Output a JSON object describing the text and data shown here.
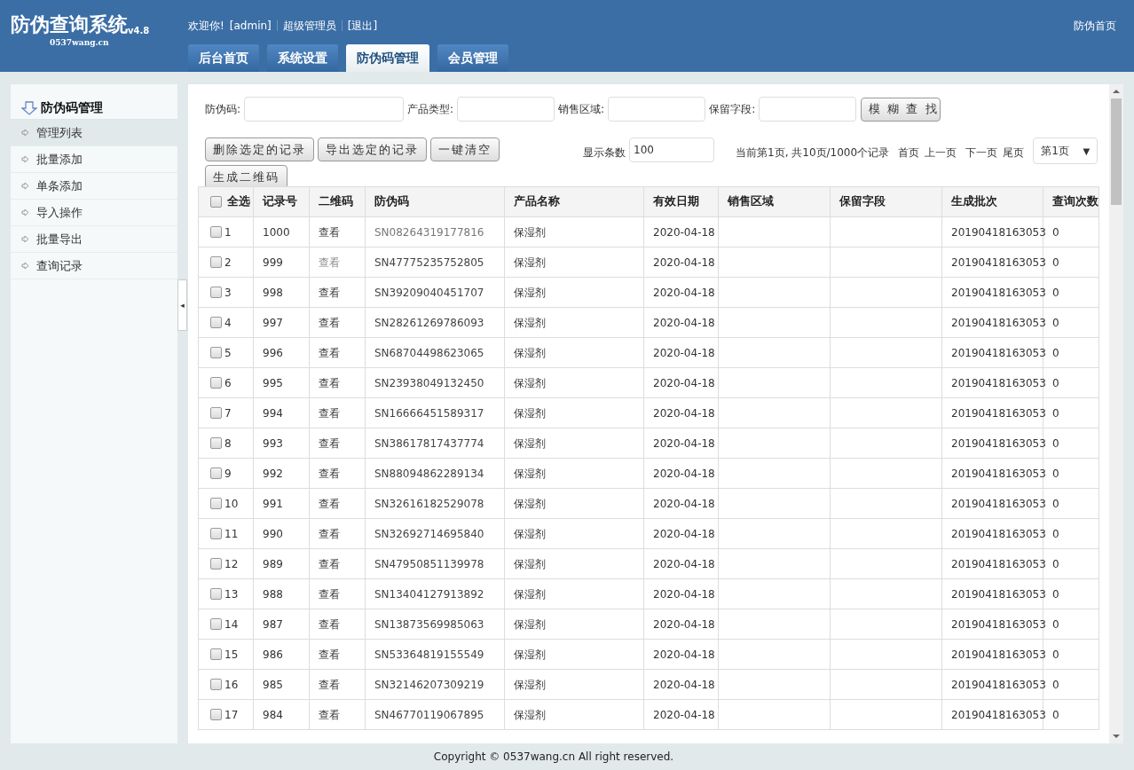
{
  "header": {
    "logo": "防伪查询系统",
    "version": "v4.8",
    "site": "0537wang.cn",
    "welcome": "欢迎你!",
    "user": "[admin]",
    "role": "超级管理员",
    "logout": "[退出]",
    "home_link": "防伪首页"
  },
  "nav_tabs": [
    {
      "label": "后台首页",
      "selected": false
    },
    {
      "label": "系统设置",
      "selected": false
    },
    {
      "label": "防伪码管理",
      "selected": true
    },
    {
      "label": "会员管理",
      "selected": false
    }
  ],
  "sidebar": {
    "title": "防伪码管理",
    "items": [
      {
        "label": "管理列表",
        "selected": true
      },
      {
        "label": "批量添加",
        "selected": false
      },
      {
        "label": "单条添加",
        "selected": false
      },
      {
        "label": "导入操作",
        "selected": false
      },
      {
        "label": "批量导出",
        "selected": false
      },
      {
        "label": "查询记录",
        "selected": false
      }
    ],
    "collapse": "◂"
  },
  "search": {
    "fields": [
      {
        "label": "防伪码:"
      },
      {
        "label": "产品类型:"
      },
      {
        "label": "销售区域:"
      },
      {
        "label": "保留字段:"
      }
    ],
    "button": "模 糊 查 找"
  },
  "actions": [
    "删除选定的记录",
    "导出选定的记录",
    "一键清空",
    "生成二维码"
  ],
  "paging": {
    "page_size_label": "显示条数",
    "page_size": "100",
    "summary": "当前第1页, 共10页/1000个记录",
    "links": [
      "首页",
      "上一页",
      "下一页",
      "尾页"
    ],
    "page_select": "第1页",
    "page_select_arrow": "▼"
  },
  "table": {
    "select_all": {
      "label": "全选",
      "checked": false
    },
    "columns": [
      "记录号",
      "二维码",
      "防伪码",
      "产品名称",
      "有效日期",
      "销售区域",
      "保留字段",
      "生成批次",
      "查询次数"
    ],
    "rows": [
      {
        "index": "1",
        "id": "1000",
        "qr": "查看",
        "qr_dimmed": false,
        "code": "SN08264319177816",
        "code_dimmed": true,
        "product": "保湿剂",
        "date": "2020-04-18",
        "batch": "20190418163053",
        "queries": "0",
        "checked": false
      },
      {
        "index": "2",
        "id": "999",
        "qr": "查看",
        "qr_dimmed": true,
        "code": "SN47775235752805",
        "code_dimmed": false,
        "product": "保湿剂",
        "date": "2020-04-18",
        "batch": "20190418163053",
        "queries": "0",
        "checked": false
      },
      {
        "index": "3",
        "id": "998",
        "qr": "查看",
        "qr_dimmed": false,
        "code": "SN39209040451707",
        "code_dimmed": false,
        "product": "保湿剂",
        "date": "2020-04-18",
        "batch": "20190418163053",
        "queries": "0",
        "checked": false
      },
      {
        "index": "4",
        "id": "997",
        "qr": "查看",
        "qr_dimmed": false,
        "code": "SN28261269786093",
        "code_dimmed": false,
        "product": "保湿剂",
        "date": "2020-04-18",
        "batch": "20190418163053",
        "queries": "0",
        "checked": false
      },
      {
        "index": "5",
        "id": "996",
        "qr": "查看",
        "qr_dimmed": false,
        "code": "SN68704498623065",
        "code_dimmed": false,
        "product": "保湿剂",
        "date": "2020-04-18",
        "batch": "20190418163053",
        "queries": "0",
        "checked": false
      },
      {
        "index": "6",
        "id": "995",
        "qr": "查看",
        "qr_dimmed": false,
        "code": "SN23938049132450",
        "code_dimmed": false,
        "product": "保湿剂",
        "date": "2020-04-18",
        "batch": "20190418163053",
        "queries": "0",
        "checked": false
      },
      {
        "index": "7",
        "id": "994",
        "qr": "查看",
        "qr_dimmed": false,
        "code": "SN16666451589317",
        "code_dimmed": false,
        "product": "保湿剂",
        "date": "2020-04-18",
        "batch": "20190418163053",
        "queries": "0",
        "checked": false
      },
      {
        "index": "8",
        "id": "993",
        "qr": "查看",
        "qr_dimmed": false,
        "code": "SN38617817437774",
        "code_dimmed": false,
        "product": "保湿剂",
        "date": "2020-04-18",
        "batch": "20190418163053",
        "queries": "0",
        "checked": false
      },
      {
        "index": "9",
        "id": "992",
        "qr": "查看",
        "qr_dimmed": false,
        "code": "SN88094862289134",
        "code_dimmed": false,
        "product": "保湿剂",
        "date": "2020-04-18",
        "batch": "20190418163053",
        "queries": "0",
        "checked": false
      },
      {
        "index": "10",
        "id": "991",
        "qr": "查看",
        "qr_dimmed": false,
        "code": "SN32616182529078",
        "code_dimmed": false,
        "product": "保湿剂",
        "date": "2020-04-18",
        "batch": "20190418163053",
        "queries": "0",
        "checked": false
      },
      {
        "index": "11",
        "id": "990",
        "qr": "查看",
        "qr_dimmed": false,
        "code": "SN32692714695840",
        "code_dimmed": false,
        "product": "保湿剂",
        "date": "2020-04-18",
        "batch": "20190418163053",
        "queries": "0",
        "checked": false
      },
      {
        "index": "12",
        "id": "989",
        "qr": "查看",
        "qr_dimmed": false,
        "code": "SN47950851139978",
        "code_dimmed": false,
        "product": "保湿剂",
        "date": "2020-04-18",
        "batch": "20190418163053",
        "queries": "0",
        "checked": false
      },
      {
        "index": "13",
        "id": "988",
        "qr": "查看",
        "qr_dimmed": false,
        "code": "SN13404127913892",
        "code_dimmed": false,
        "product": "保湿剂",
        "date": "2020-04-18",
        "batch": "20190418163053",
        "queries": "0",
        "checked": false
      },
      {
        "index": "14",
        "id": "987",
        "qr": "查看",
        "qr_dimmed": false,
        "code": "SN13873569985063",
        "code_dimmed": false,
        "product": "保湿剂",
        "date": "2020-04-18",
        "batch": "20190418163053",
        "queries": "0",
        "checked": false
      },
      {
        "index": "15",
        "id": "986",
        "qr": "查看",
        "qr_dimmed": false,
        "code": "SN53364819155549",
        "code_dimmed": false,
        "product": "保湿剂",
        "date": "2020-04-18",
        "batch": "20190418163053",
        "queries": "0",
        "checked": false
      },
      {
        "index": "16",
        "id": "985",
        "qr": "查看",
        "qr_dimmed": false,
        "code": "SN32146207309219",
        "code_dimmed": false,
        "product": "保湿剂",
        "date": "2020-04-18",
        "batch": "20190418163053",
        "queries": "0",
        "checked": false
      },
      {
        "index": "17",
        "id": "984",
        "qr": "查看",
        "qr_dimmed": false,
        "code": "SN46770119067895",
        "code_dimmed": false,
        "product": "保湿剂",
        "date": "2020-04-18",
        "batch": "20190418163053",
        "queries": "0",
        "checked": false
      }
    ]
  },
  "footer": "Copyright © 0537wang.cn All right reserved."
}
